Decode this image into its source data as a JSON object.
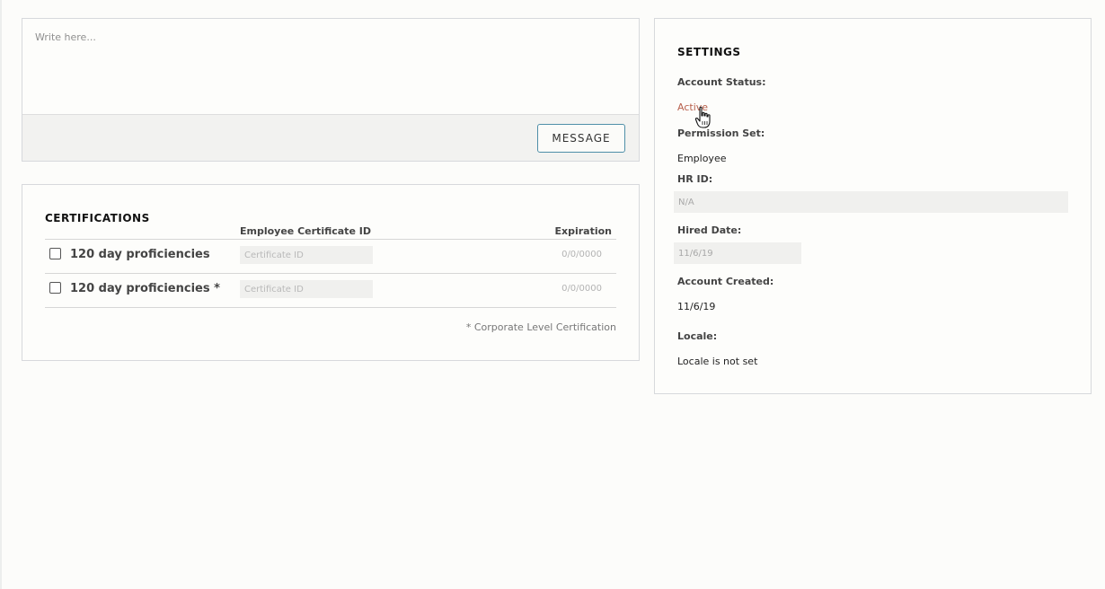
{
  "composer": {
    "placeholder": "Write here...",
    "send_label": "MESSAGE"
  },
  "certifications": {
    "title": "CERTIFICATIONS",
    "columns": {
      "certificate_id": "Employee Certificate ID",
      "expiration": "Expiration"
    },
    "rows": [
      {
        "name": "120 day proficiencies",
        "certificate_placeholder": "Certificate ID",
        "expiration": "0/0/0000",
        "checked": false
      },
      {
        "name": "120 day proficiencies *",
        "certificate_placeholder": "Certificate ID",
        "expiration": "0/0/0000",
        "checked": false
      }
    ],
    "footnote": "* Corporate Level Certification"
  },
  "settings": {
    "title": "SETTINGS",
    "account_status_label": "Account Status:",
    "account_status_value": "Active",
    "permission_set_label": "Permission Set:",
    "permission_set_value": "Employee",
    "hr_id_label": "HR ID:",
    "hr_id_value": "N/A",
    "hired_date_label": "Hired Date:",
    "hired_date_value": "11/6/19",
    "account_created_label": "Account Created:",
    "account_created_value": "11/6/19",
    "locale_label": "Locale:",
    "locale_value": "Locale is not set"
  },
  "colors": {
    "accent_border": "#4f8fa8",
    "link": "#b8604c"
  }
}
